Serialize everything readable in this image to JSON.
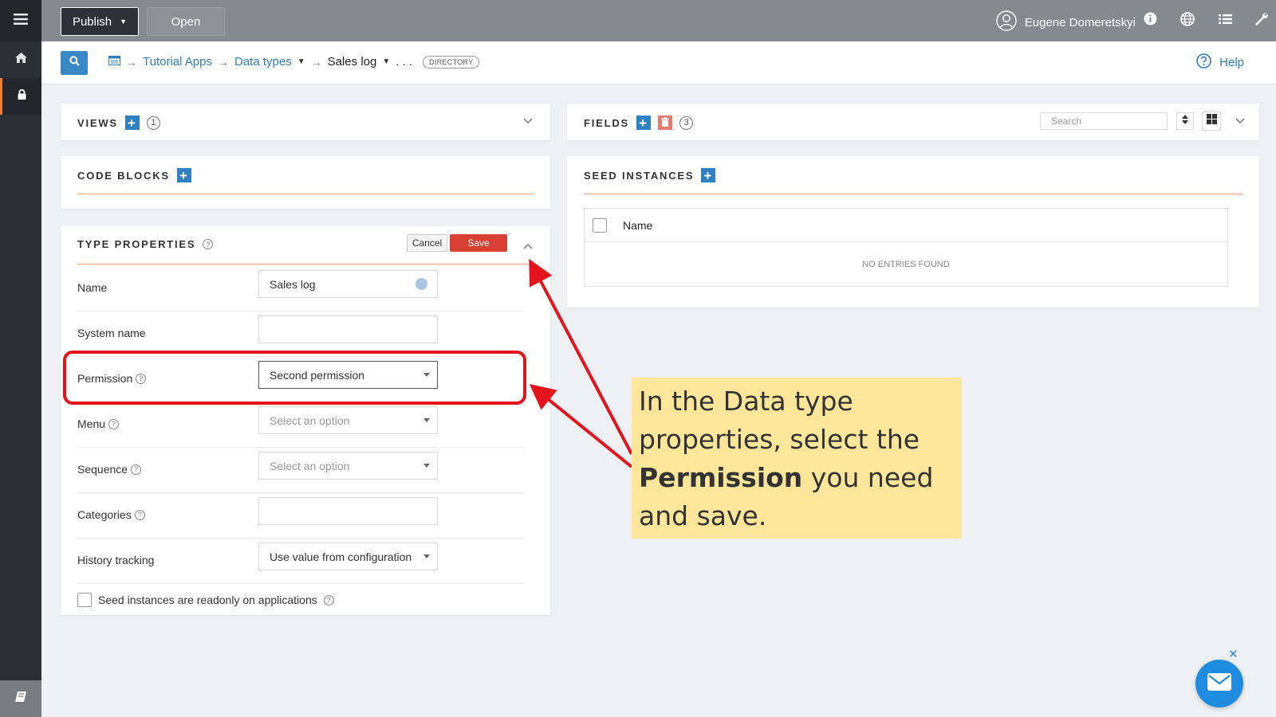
{
  "topbar": {
    "publish_label": "Publish",
    "open_label": "Open",
    "user_name": "Eugene Domeretskyi"
  },
  "breadcrumb": {
    "items": [
      "Tutorial Apps",
      "Data types",
      "Sales log"
    ],
    "more": ". . .",
    "badge": "DIRECTORY",
    "help_label": "Help"
  },
  "views": {
    "title": "VIEWS",
    "count": "1"
  },
  "code_blocks": {
    "title": "CODE BLOCKS"
  },
  "type_properties": {
    "title": "TYPE PROPERTIES",
    "cancel_label": "Cancel",
    "save_label": "Save",
    "fields": {
      "name": {
        "label": "Name",
        "value": "Sales log"
      },
      "system_name": {
        "label": "System name",
        "value": ""
      },
      "permission": {
        "label": "Permission",
        "value": "Second permission"
      },
      "menu": {
        "label": "Menu",
        "placeholder": "Select an option"
      },
      "sequence": {
        "label": "Sequence",
        "placeholder": "Select an option"
      },
      "categories": {
        "label": "Categories",
        "value": ""
      },
      "history_tracking": {
        "label": "History tracking",
        "value": "Use value from configuration"
      }
    },
    "seed_readonly_label": "Seed instances are readonly on applications",
    "seed_readonly_checked": false
  },
  "fields_panel": {
    "title": "FIELDS",
    "count": "3",
    "search_placeholder": "Search"
  },
  "seed_instances": {
    "title": "SEED INSTANCES",
    "column_name": "Name",
    "empty_text": "NO ENTRIES FOUND"
  },
  "annotation": {
    "line1": "In the Data type",
    "line2": "properties, select the",
    "bold": "Permission",
    "line3_rest": " you need",
    "line4": "and save."
  },
  "colors": {
    "accent_blue": "#2f80c3",
    "save_red": "#d94034",
    "annotation_red": "#e3141b",
    "callout_yellow": "#fde59a",
    "divider_orange": "#f0a07d"
  },
  "icons": [
    "menu-icon",
    "home-icon",
    "lock-icon",
    "book-icon",
    "user-icon",
    "info-icon",
    "globe-icon",
    "list-icon",
    "wrench-icon",
    "search-icon",
    "help-icon",
    "plus-icon",
    "trash-icon",
    "chevron-down-icon",
    "chevron-up-icon",
    "mail-icon",
    "close-icon"
  ]
}
